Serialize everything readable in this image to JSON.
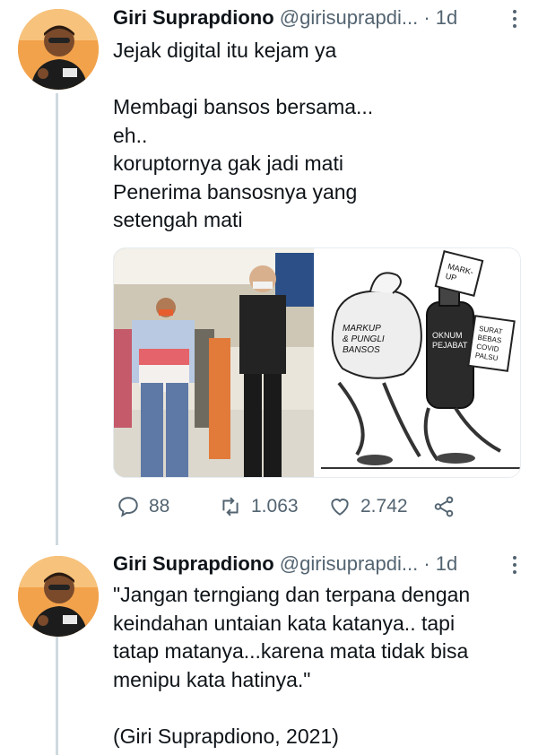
{
  "tweets": [
    {
      "author": {
        "name": "Giri Suprapdiono",
        "handle": "@girisuprapdi...",
        "time": "1d",
        "separator": "·"
      },
      "text": "Jejak digital itu kejam ya\n\nMembagi bansos bersama...\neh..\nkoruptornya gak jadi mati\nPenerima bansosnya yang\nsetengah mati",
      "media": {
        "photo_icon": "photo-bansos-distribution",
        "cartoon_labels": {
          "sack": "MARKUP\n& PUNGLI\nBANSOS",
          "bottle": "OKNUM\nPEJABAT",
          "tag_top": "MARK-\nUP",
          "tag_right": "SURAT\nBEBAS\nCOVID\nPALSU"
        }
      },
      "actions": {
        "replies": "88",
        "retweets": "1.063",
        "likes": "2.742"
      }
    },
    {
      "author": {
        "name": "Giri Suprapdiono",
        "handle": "@girisuprapdi...",
        "time": "1d",
        "separator": "·"
      },
      "text": "\"Jangan terngiang dan terpana dengan\nkeindahan untaian kata katanya.. tapi\ntatap matanya...karena mata tidak bisa\nmenipu kata hatinya.\"\n\n(Giri Suprapdiono, 2021)"
    }
  ],
  "icons": {
    "reply": "reply-icon",
    "retweet": "retweet-icon",
    "like": "heart-icon",
    "share": "share-icon",
    "more": "more-vertical-icon"
  },
  "colors": {
    "text": "#0f1419",
    "secondary": "#536471",
    "thread": "#cfd9de"
  }
}
